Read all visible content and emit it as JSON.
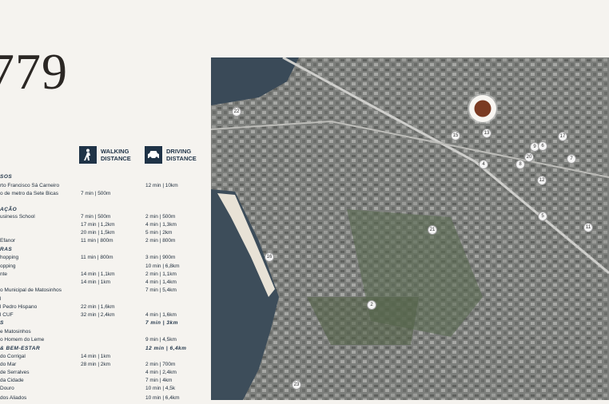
{
  "title": "779",
  "legend": {
    "walking": "WALKING\nDISTANCE",
    "driving": "DRIVING\nDISTANCE"
  },
  "rows": [
    {
      "label": "SOS",
      "walk": "",
      "drive": "",
      "section": true
    },
    {
      "label": "rto Francisco Sá Carneiro",
      "walk": "",
      "drive": "12 min | 10km"
    },
    {
      "label": "o de metro da Sete Bicas",
      "walk": "7 min | 500m",
      "drive": ""
    },
    {
      "label": "AÇÃO",
      "walk": "",
      "drive": "",
      "section": true
    },
    {
      "label": "usiness School",
      "walk": "7 min | 500m",
      "drive": "2 min | 500m"
    },
    {
      "label": "",
      "walk": "17 min | 1,2km",
      "drive": "4 min | 1,3km"
    },
    {
      "label": "",
      "walk": "20 min | 1,5km",
      "drive": "5 min | 2km"
    },
    {
      "label": "Efanor",
      "walk": "11 min | 800m",
      "drive": "2 min | 800m"
    },
    {
      "label": "RAS",
      "walk": "",
      "drive": "",
      "section": true
    },
    {
      "label": "hopping",
      "walk": "11 min | 800m",
      "drive": "3 min | 900m"
    },
    {
      "label": "opping",
      "walk": "",
      "drive": "10 min | 6,8km"
    },
    {
      "label": "nte",
      "walk": "14 min | 1,1km",
      "drive": "2 min | 1,1km"
    },
    {
      "label": "",
      "walk": "14 min | 1km",
      "drive": "4 min | 1,4km"
    },
    {
      "label": "o Municipal de Matosinhos",
      "walk": "",
      "drive": "7 min | 5,4km"
    },
    {
      "label": "l",
      "walk": "",
      "drive": ""
    },
    {
      "label": "l Pedro Hispano",
      "walk": "22 min | 1,6km",
      "drive": ""
    },
    {
      "label": "l CUF",
      "walk": "32 min | 2,4km",
      "drive": "4 min | 1,6km"
    },
    {
      "label": "S",
      "walk": "",
      "drive": "7 min | 3km",
      "section": true
    },
    {
      "label": "e Matosinhos",
      "walk": "",
      "drive": ""
    },
    {
      "label": "o Homem do Leme",
      "walk": "",
      "drive": "9 min | 4,5km"
    },
    {
      "label": "& BEM-ESTAR",
      "walk": "",
      "drive": "12 min | 6,4km",
      "section": true
    },
    {
      "label": "do Corrigal",
      "walk": "14 min | 1km",
      "drive": ""
    },
    {
      "label": "do Mar",
      "walk": "28 min | 2km",
      "drive": "2 min | 700m"
    },
    {
      "label": "de Serralves",
      "walk": "",
      "drive": "4 min | 2,4km"
    },
    {
      "label": "da Cidade",
      "walk": "",
      "drive": "7 min | 4km"
    },
    {
      "label": "Douro",
      "walk": "",
      "drive": "10 min | 4,5k"
    },
    {
      "label": "dos Aliados",
      "walk": "",
      "drive": "10 min | 6,4km"
    }
  ],
  "map_pins": [
    "22",
    "15",
    "13",
    "17",
    "9",
    "6",
    "7",
    "4",
    "8",
    "12",
    "5",
    "11",
    "21",
    "16",
    "2",
    "23",
    "20"
  ]
}
